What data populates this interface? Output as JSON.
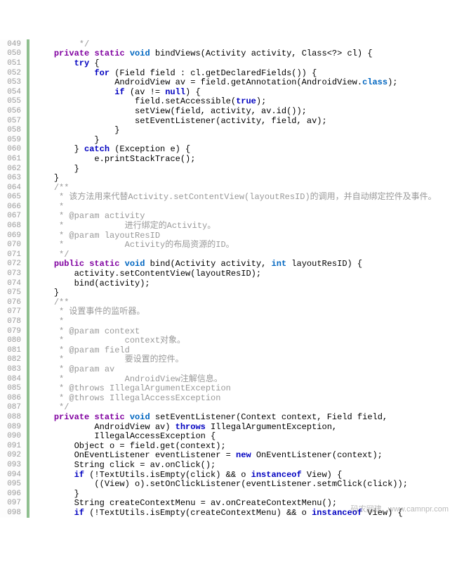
{
  "watermark": "码农网建   www.camnpr.com",
  "lines": [
    {
      "n": "049",
      "indent": 8,
      "segs": [
        {
          "c": "comment",
          "t": " */"
        }
      ]
    },
    {
      "n": "050",
      "indent": 4,
      "segs": [
        {
          "c": "kw-acc",
          "t": "private"
        },
        {
          "t": " "
        },
        {
          "c": "kw-acc",
          "t": "static"
        },
        {
          "t": " "
        },
        {
          "c": "kw-type",
          "t": "void"
        },
        {
          "t": " bindViews(Activity activity, Class<?> cl) {"
        }
      ]
    },
    {
      "n": "051",
      "indent": 8,
      "segs": [
        {
          "c": "kw-ctrl",
          "t": "try"
        },
        {
          "t": " {"
        }
      ]
    },
    {
      "n": "052",
      "indent": 12,
      "segs": [
        {
          "c": "kw-ctrl",
          "t": "for"
        },
        {
          "t": " (Field field : cl.getDeclaredFields()) {"
        }
      ]
    },
    {
      "n": "053",
      "indent": 16,
      "segs": [
        {
          "t": "AndroidView av = field.getAnnotation(AndroidView."
        },
        {
          "c": "kw-type",
          "t": "class"
        },
        {
          "t": ");"
        }
      ]
    },
    {
      "n": "054",
      "indent": 16,
      "segs": [
        {
          "c": "kw-ctrl",
          "t": "if"
        },
        {
          "t": " (av != "
        },
        {
          "c": "kw-lit",
          "t": "null"
        },
        {
          "t": ") {"
        }
      ]
    },
    {
      "n": "055",
      "indent": 20,
      "segs": [
        {
          "t": "field.setAccessible("
        },
        {
          "c": "kw-lit",
          "t": "true"
        },
        {
          "t": ");"
        }
      ]
    },
    {
      "n": "056",
      "indent": 20,
      "segs": [
        {
          "t": "setView(field, activity, av.id());"
        }
      ]
    },
    {
      "n": "057",
      "indent": 20,
      "segs": [
        {
          "t": "setEventListener(activity, field, av);"
        }
      ]
    },
    {
      "n": "058",
      "indent": 16,
      "segs": [
        {
          "t": "}"
        }
      ]
    },
    {
      "n": "059",
      "indent": 12,
      "segs": [
        {
          "t": "}"
        }
      ]
    },
    {
      "n": "060",
      "indent": 8,
      "segs": [
        {
          "t": "} "
        },
        {
          "c": "kw-ctrl",
          "t": "catch"
        },
        {
          "t": " (Exception e) {"
        }
      ]
    },
    {
      "n": "061",
      "indent": 12,
      "segs": [
        {
          "t": "e.printStackTrace();"
        }
      ]
    },
    {
      "n": "062",
      "indent": 8,
      "segs": [
        {
          "t": "}"
        }
      ]
    },
    {
      "n": "063",
      "indent": 4,
      "segs": [
        {
          "t": "}"
        }
      ]
    },
    {
      "n": "064",
      "indent": 4,
      "segs": [
        {
          "c": "comment",
          "t": "/**"
        }
      ]
    },
    {
      "n": "065",
      "indent": 4,
      "segs": [
        {
          "c": "comment",
          "t": " * 该方法用来代替Activity.setContentView(layoutResID)的调用，并自动绑定控件及事件。"
        }
      ]
    },
    {
      "n": "066",
      "indent": 4,
      "segs": [
        {
          "c": "comment",
          "t": " * "
        }
      ]
    },
    {
      "n": "067",
      "indent": 4,
      "segs": [
        {
          "c": "comment",
          "t": " * @param activity"
        }
      ]
    },
    {
      "n": "068",
      "indent": 4,
      "segs": [
        {
          "c": "comment",
          "t": " *            进行绑定的Activity。"
        }
      ]
    },
    {
      "n": "069",
      "indent": 4,
      "segs": [
        {
          "c": "comment",
          "t": " * @param layoutResID"
        }
      ]
    },
    {
      "n": "070",
      "indent": 4,
      "segs": [
        {
          "c": "comment",
          "t": " *            Activity的布局资源的ID。"
        }
      ]
    },
    {
      "n": "071",
      "indent": 4,
      "segs": [
        {
          "c": "comment",
          "t": " */"
        }
      ]
    },
    {
      "n": "072",
      "indent": 4,
      "segs": [
        {
          "c": "kw-acc",
          "t": "public"
        },
        {
          "t": " "
        },
        {
          "c": "kw-acc",
          "t": "static"
        },
        {
          "t": " "
        },
        {
          "c": "kw-type",
          "t": "void"
        },
        {
          "t": " bind(Activity activity, "
        },
        {
          "c": "kw-type",
          "t": "int"
        },
        {
          "t": " layoutResID) {"
        }
      ]
    },
    {
      "n": "073",
      "indent": 8,
      "segs": [
        {
          "t": "activity.setContentView(layoutResID);"
        }
      ]
    },
    {
      "n": "074",
      "indent": 8,
      "segs": [
        {
          "t": "bind(activity);"
        }
      ]
    },
    {
      "n": "075",
      "indent": 4,
      "segs": [
        {
          "t": "}"
        }
      ]
    },
    {
      "n": "076",
      "indent": 4,
      "segs": [
        {
          "c": "comment",
          "t": "/**"
        }
      ]
    },
    {
      "n": "077",
      "indent": 4,
      "segs": [
        {
          "c": "comment",
          "t": " * 设置事件的监听器。"
        }
      ]
    },
    {
      "n": "078",
      "indent": 4,
      "segs": [
        {
          "c": "comment",
          "t": " * "
        }
      ]
    },
    {
      "n": "079",
      "indent": 4,
      "segs": [
        {
          "c": "comment",
          "t": " * @param context"
        }
      ]
    },
    {
      "n": "080",
      "indent": 4,
      "segs": [
        {
          "c": "comment",
          "t": " *            context对象。"
        }
      ]
    },
    {
      "n": "081",
      "indent": 4,
      "segs": [
        {
          "c": "comment",
          "t": " * @param field"
        }
      ]
    },
    {
      "n": "082",
      "indent": 4,
      "segs": [
        {
          "c": "comment",
          "t": " *            要设置的控件。"
        }
      ]
    },
    {
      "n": "083",
      "indent": 4,
      "segs": [
        {
          "c": "comment",
          "t": " * @param av"
        }
      ]
    },
    {
      "n": "084",
      "indent": 4,
      "segs": [
        {
          "c": "comment",
          "t": " *            AndroidView注解信息。"
        }
      ]
    },
    {
      "n": "085",
      "indent": 4,
      "segs": [
        {
          "c": "comment",
          "t": " * @throws IllegalArgumentException"
        }
      ]
    },
    {
      "n": "086",
      "indent": 4,
      "segs": [
        {
          "c": "comment",
          "t": " * @throws IllegalAccessException"
        }
      ]
    },
    {
      "n": "087",
      "indent": 4,
      "segs": [
        {
          "c": "comment",
          "t": " */"
        }
      ]
    },
    {
      "n": "088",
      "indent": 4,
      "segs": [
        {
          "c": "kw-acc",
          "t": "private"
        },
        {
          "t": " "
        },
        {
          "c": "kw-acc",
          "t": "static"
        },
        {
          "t": " "
        },
        {
          "c": "kw-type",
          "t": "void"
        },
        {
          "t": " setEventListener(Context context, Field field,"
        }
      ]
    },
    {
      "n": "089",
      "indent": 12,
      "segs": [
        {
          "t": "AndroidView av) "
        },
        {
          "c": "kw-ctrl",
          "t": "throws"
        },
        {
          "t": " IllegalArgumentException,"
        }
      ]
    },
    {
      "n": "090",
      "indent": 12,
      "segs": [
        {
          "t": "IllegalAccessException {"
        }
      ]
    },
    {
      "n": "091",
      "indent": 8,
      "segs": [
        {
          "t": "Object o = field.get(context);"
        }
      ]
    },
    {
      "n": "092",
      "indent": 8,
      "segs": [
        {
          "t": "OnEventListener eventListener = "
        },
        {
          "c": "kw-lit",
          "t": "new"
        },
        {
          "t": " OnEventListener(context);"
        }
      ]
    },
    {
      "n": "093",
      "indent": 8,
      "segs": [
        {
          "t": "String click = av.onClick();"
        }
      ]
    },
    {
      "n": "094",
      "indent": 8,
      "segs": [
        {
          "c": "kw-ctrl",
          "t": "if"
        },
        {
          "t": " (!TextUtils.isEmpty(click) && o "
        },
        {
          "c": "kw-lit",
          "t": "instanceof"
        },
        {
          "t": " View) {"
        }
      ]
    },
    {
      "n": "095",
      "indent": 12,
      "segs": [
        {
          "t": "((View) o).setOnClickListener(eventListener.setmClick(click));"
        }
      ]
    },
    {
      "n": "096",
      "indent": 8,
      "segs": [
        {
          "t": "}"
        }
      ]
    },
    {
      "n": "097",
      "indent": 8,
      "segs": [
        {
          "t": "String createContextMenu = av.onCreateContextMenu();"
        }
      ]
    },
    {
      "n": "098",
      "indent": 8,
      "segs": [
        {
          "c": "kw-ctrl",
          "t": "if"
        },
        {
          "t": " (!TextUtils.isEmpty(createContextMenu) && o "
        },
        {
          "c": "kw-lit",
          "t": "instanceof"
        },
        {
          "t": " View) {"
        }
      ]
    }
  ]
}
